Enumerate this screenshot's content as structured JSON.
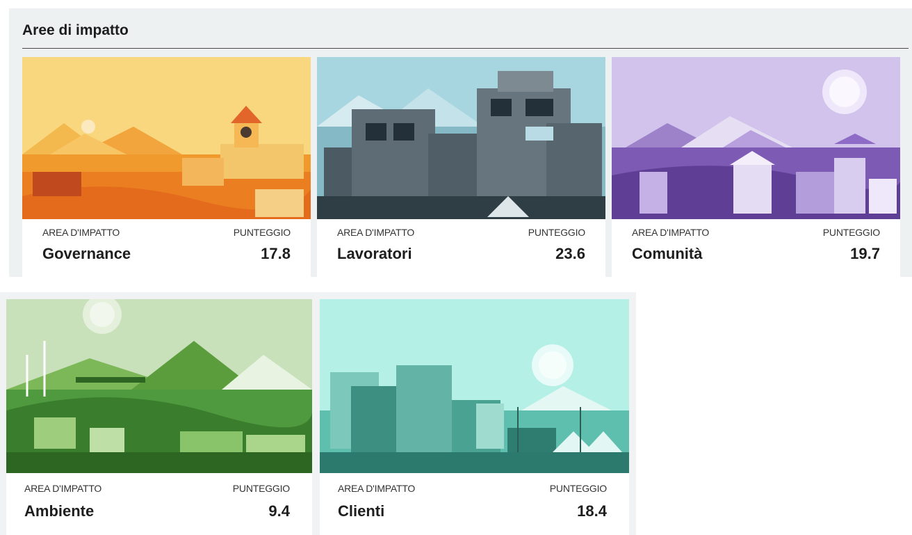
{
  "section": {
    "title": "Aree di impatto"
  },
  "cards": [
    {
      "area_label": "AREA D'IMPATTO",
      "score_label": "PUNTEGGIO",
      "name": "Governance",
      "score": "17.8"
    },
    {
      "area_label": "AREA D'IMPATTO",
      "score_label": "PUNTEGGIO",
      "name": "Lavoratori",
      "score": "23.6"
    },
    {
      "area_label": "AREA D'IMPATTO",
      "score_label": "PUNTEGGIO",
      "name": "Comunità",
      "score": "19.7"
    },
    {
      "area_label": "AREA D'IMPATTO",
      "score_label": "PUNTEGGIO",
      "name": "Ambiente",
      "score": "9.4"
    },
    {
      "area_label": "AREA D'IMPATTO",
      "score_label": "PUNTEGGIO",
      "name": "Clienti",
      "score": "18.4"
    }
  ],
  "colors": {
    "governance": "#f5b13b",
    "lavoratori": "#9fcfdc",
    "comunita": "#b8a0dc",
    "ambiente": "#7fbf63",
    "clienti": "#8fe2d6"
  }
}
